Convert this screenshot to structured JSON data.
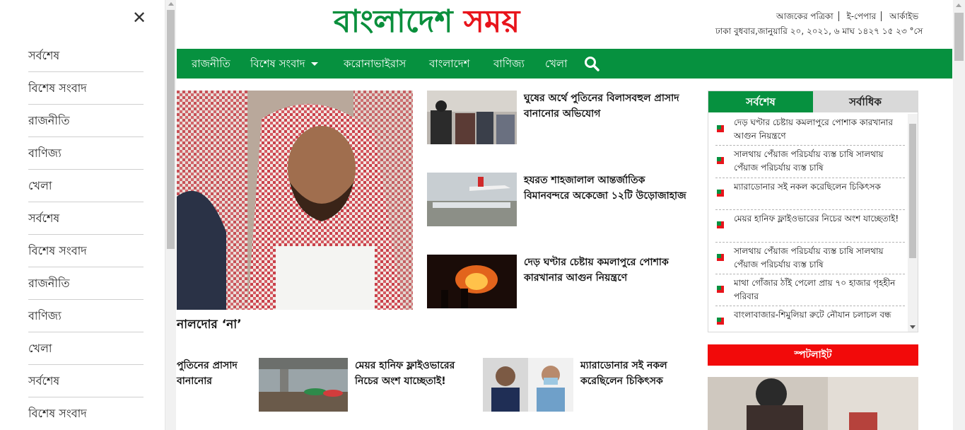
{
  "sidebar": {
    "close_symbol": "✕",
    "items": [
      {
        "label": "সর্বশেষ"
      },
      {
        "label": "বিশেষ সংবাদ"
      },
      {
        "label": "রাজনীতি"
      },
      {
        "label": "বাণিজ্য"
      },
      {
        "label": "খেলা"
      },
      {
        "label": "সর্বশেষ"
      },
      {
        "label": "বিশেষ সংবাদ"
      },
      {
        "label": "রাজনীতি"
      },
      {
        "label": "বাণিজ্য"
      },
      {
        "label": "খেলা"
      },
      {
        "label": "সর্বশেষ"
      },
      {
        "label": "বিশেষ সংবাদ"
      }
    ]
  },
  "header": {
    "logo_part1": "বাংলাদেশ",
    "logo_part2": "সময়",
    "logo_colors": {
      "part1": "#0a8f3c",
      "part2": "#e8141b"
    },
    "toplinks": [
      "আজকের পত্রিকা",
      "ই-পেপার",
      "আর্কাইভ"
    ],
    "dateline": "ঢাকা বুধবার,জানুয়ারি ২০, ২০২১, ৬ মাঘ ১৪২৭ ১৫ ২৩ °সে"
  },
  "nav": {
    "items": [
      "রাজনীতি",
      "বিশেষ সংবাদ",
      "করোনাভাইরাস",
      "বাংলাদেশ",
      "বাণিজ্য",
      "খেলা"
    ],
    "accent": "#06913f"
  },
  "lead": {
    "title_fragment": "নালদোর ‘না’"
  },
  "side_stories": [
    {
      "title": "ঘুষের অর্থে পুতিনের বিলাসবহুল প্রাসাদ বানানোর অভিযোগ"
    },
    {
      "title": "হযরত শাহজালাল আন্তর্জাতিক বিমানবন্দরে অকেজো ১২টি উড়োজাহাজ"
    },
    {
      "title": "দেড় ঘণ্টার চেষ্টায় কমলাপুরে পোশাক কারখানার আগুন নিয়ন্ত্রণে"
    }
  ],
  "bottom_stories": [
    {
      "title": "পুতিনের প্রাসাদ বানানোর"
    },
    {
      "title": "মেয়র হানিফ ফ্লাইওভারের নিচের অংশ যাচ্ছেতাই!"
    },
    {
      "title": "ম্যারাডোনার সই নকল করেছিলেন চিকিৎসক"
    }
  ],
  "latest_widget": {
    "tab_active": "সর্বশেষ",
    "tab_inactive": "সর্বাধিক",
    "items": [
      {
        "title": "দেড় ঘণ্টার চেষ্টায় কমলাপুরে পোশাক কারখানার আগুন নিয়ন্ত্রণে"
      },
      {
        "title": "সালথায় পেঁয়াজ পরিচর্যায় ব্যস্ত চাষি সালথায় পেঁয়াজ পরিচর্যায় ব্যস্ত চাষি"
      },
      {
        "title": "ম্যারাডোনার সই নকল করেছিলেন চিকিৎসক"
      },
      {
        "title": "মেয়র হানিফ ফ্লাইওভারের নিচের অংশ যাচ্ছেতাই!"
      },
      {
        "title": "সালথায় পেঁয়াজ পরিচর্যায় ব্যস্ত চাষি সালথায় পেঁয়াজ পরিচর্যায় ব্যস্ত চাষি"
      },
      {
        "title": "মাথা গোঁজার ঠাঁই পেলো প্রায় ৭০ হাজার গৃহহীন পরিবার"
      },
      {
        "title": "বাংলাবাজার-শিমুলিয়া রুটে নৌযান চলাচল বন্ধ"
      }
    ]
  },
  "spotlight": {
    "label": "স্পটলাইট",
    "color": "#f20a0a"
  }
}
